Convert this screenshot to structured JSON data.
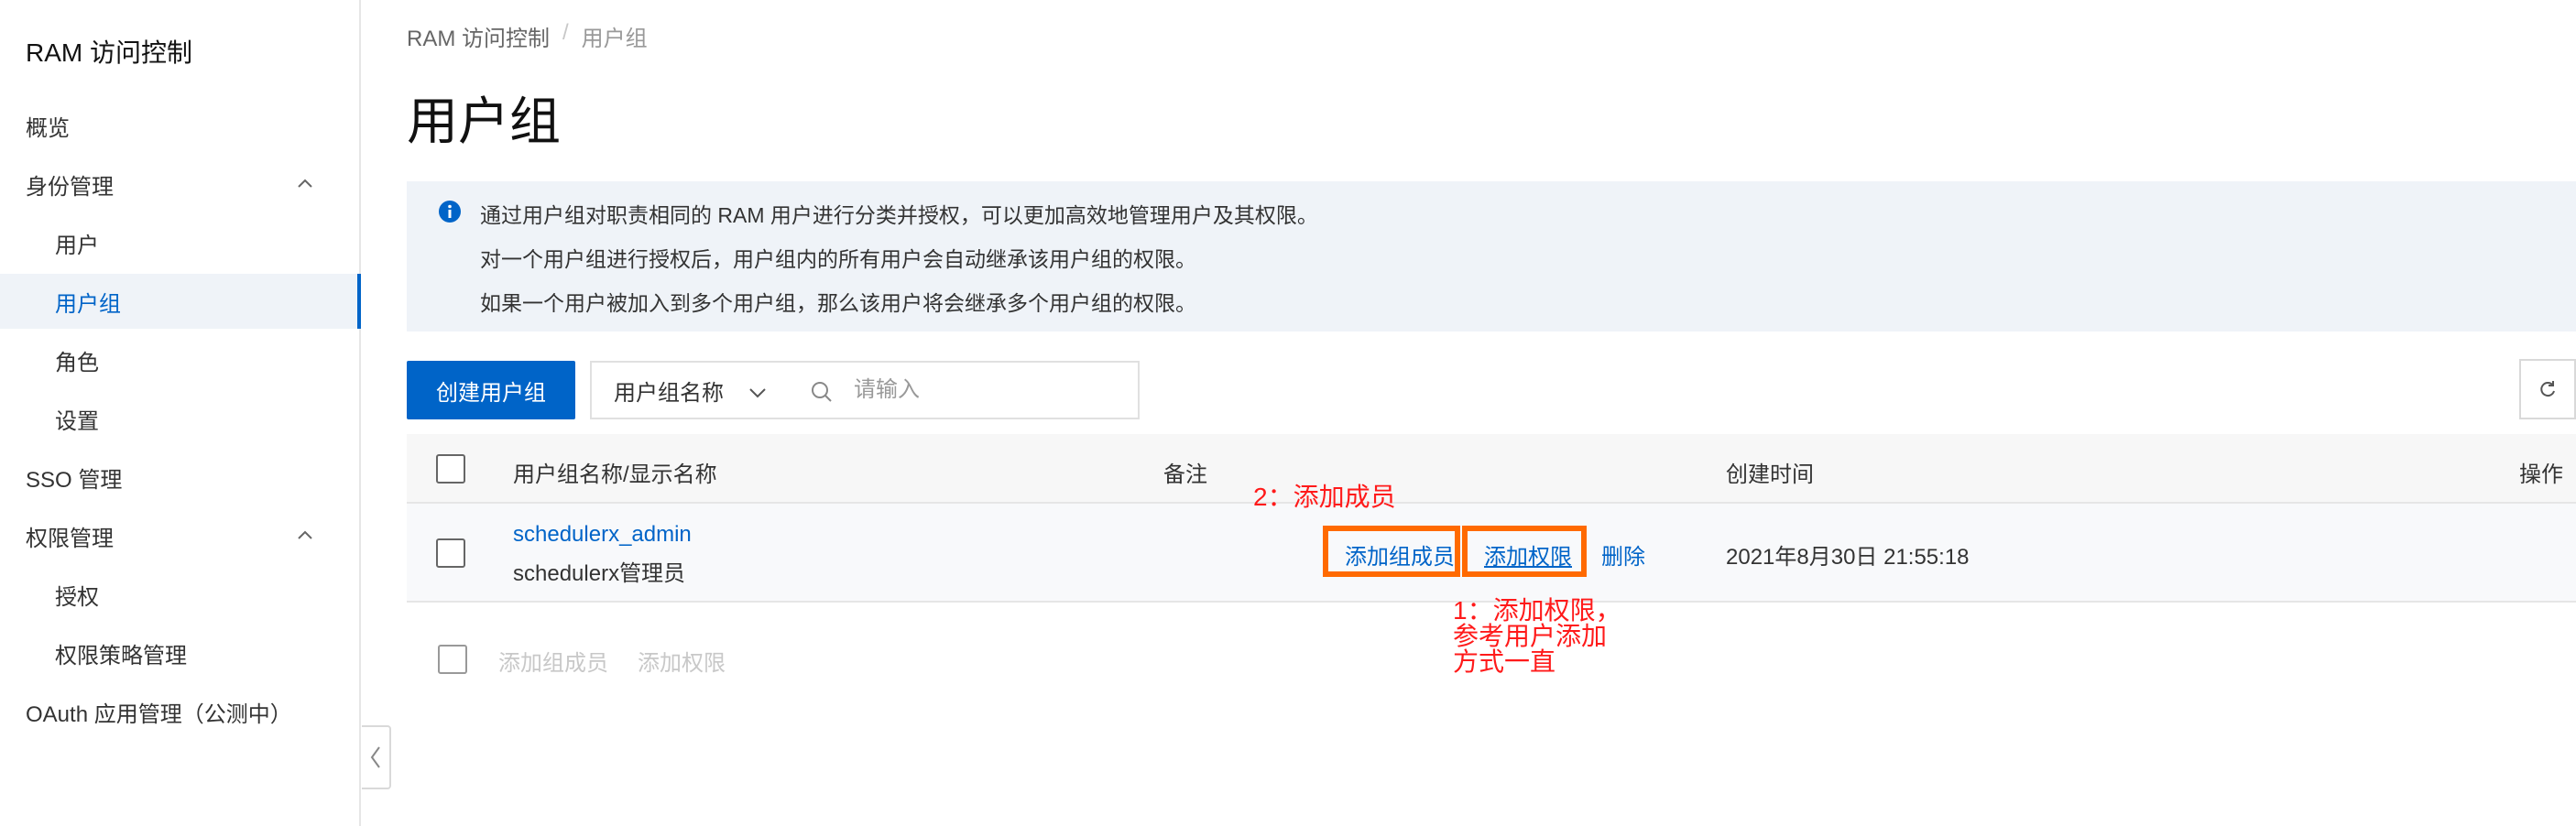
{
  "sidebar": {
    "title": "RAM 访问控制",
    "items": [
      {
        "label": "概览"
      },
      {
        "label": "身份管理"
      },
      {
        "label": "用户"
      },
      {
        "label": "用户组"
      },
      {
        "label": "角色"
      },
      {
        "label": "设置"
      },
      {
        "label": "SSO 管理"
      },
      {
        "label": "权限管理"
      },
      {
        "label": "授权"
      },
      {
        "label": "权限策略管理"
      },
      {
        "label": "OAuth 应用管理（公测中）"
      }
    ],
    "active_item": "用户组"
  },
  "breadcrumb": {
    "root": "RAM 访问控制",
    "separator": "/",
    "current": "用户组"
  },
  "page_title": "用户组",
  "info": {
    "lines": [
      "通过用户组对职责相同的 RAM 用户进行分类并授权，可以更加高效地管理用户及其权限。",
      "对一个用户组进行授权后，用户组内的所有用户会自动继承该用户组的权限。",
      "如果一个用户被加入到多个用户组，那么该用户将会继承多个用户组的权限。"
    ]
  },
  "toolbar": {
    "create_label": "创建用户组",
    "filter_selected": "用户组名称",
    "search_placeholder": "请输入"
  },
  "table": {
    "headers": {
      "name": "用户组名称/显示名称",
      "remark": "备注",
      "created": "创建时间",
      "actions": "操作"
    },
    "rows": [
      {
        "name": "schedulerx_admin",
        "display_name": "schedulerx管理员",
        "remark": "",
        "created": "2021年8月30日 21:55:18",
        "actions": {
          "add_members": "添加组成员",
          "add_permissions": "添加权限",
          "delete": "删除"
        }
      }
    ]
  },
  "batch": {
    "add_members": "添加组成员",
    "add_permissions": "添加权限"
  },
  "annotations": {
    "step2": "2：添加成员",
    "step1": [
      "1：添加权限，",
      "参考用户添加",
      "方式一直"
    ]
  },
  "colors": {
    "primary": "#0064c8",
    "highlight": "#ff6a00",
    "annotation": "#ff1a1a",
    "info_bg": "#eff3f8"
  }
}
